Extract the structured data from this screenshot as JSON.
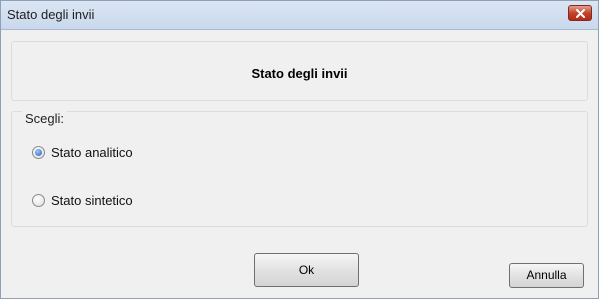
{
  "window": {
    "title": "Stato degli invii",
    "close_icon": "close-icon"
  },
  "header": {
    "title": "Stato degli invii"
  },
  "options": {
    "legend": "Scegli:",
    "items": [
      {
        "label": "Stato analitico",
        "selected": true
      },
      {
        "label": "Stato sintetico",
        "selected": false
      }
    ]
  },
  "buttons": {
    "ok_label": "Ok",
    "cancel_label": "Annulla"
  },
  "colors": {
    "close_button": "#c3432b",
    "window_bg": "#f0f0f0",
    "titlebar": "#c9d8ec"
  }
}
